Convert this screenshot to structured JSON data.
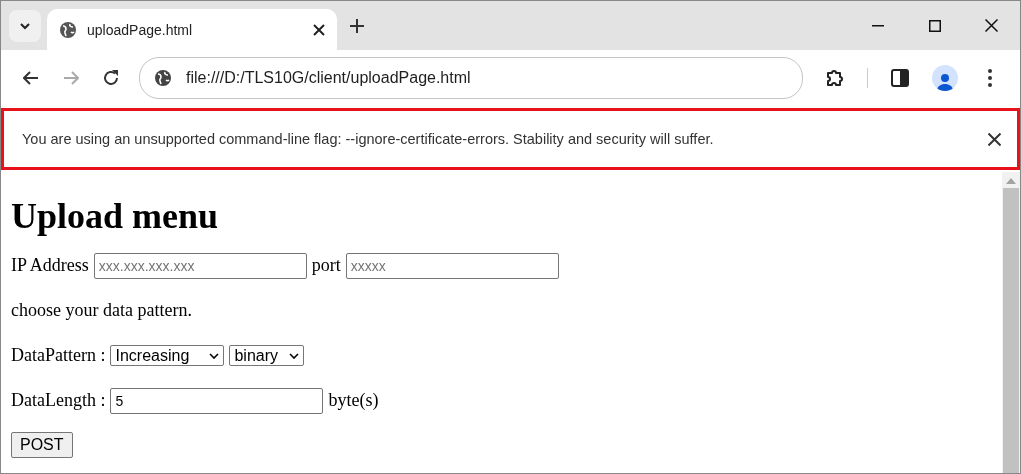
{
  "tabs": [
    {
      "title": "uploadPage.html",
      "selected": true
    }
  ],
  "address_bar": {
    "value": "file:///D:/TLS10G/client/uploadPage.html"
  },
  "infobar": {
    "message": "You are using an unsupported command-line flag: --ignore-certificate-errors. Stability and security will suffer."
  },
  "page": {
    "heading": "Upload menu",
    "ip_label": "IP Address",
    "ip_field": {
      "placeholder": "xxx.xxx.xxx.xxx"
    },
    "port_label": "port",
    "port_field": {
      "placeholder": "xxxxx"
    },
    "instruction": "choose your data pattern.",
    "pattern_label": "DataPattern :",
    "pattern_selects": [
      {
        "value": "Increasing"
      },
      {
        "value": "binary"
      }
    ],
    "length_label": "DataLength :",
    "length_field": {
      "value": "5"
    },
    "length_unit": "byte(s)",
    "submit_button": "POST"
  }
}
